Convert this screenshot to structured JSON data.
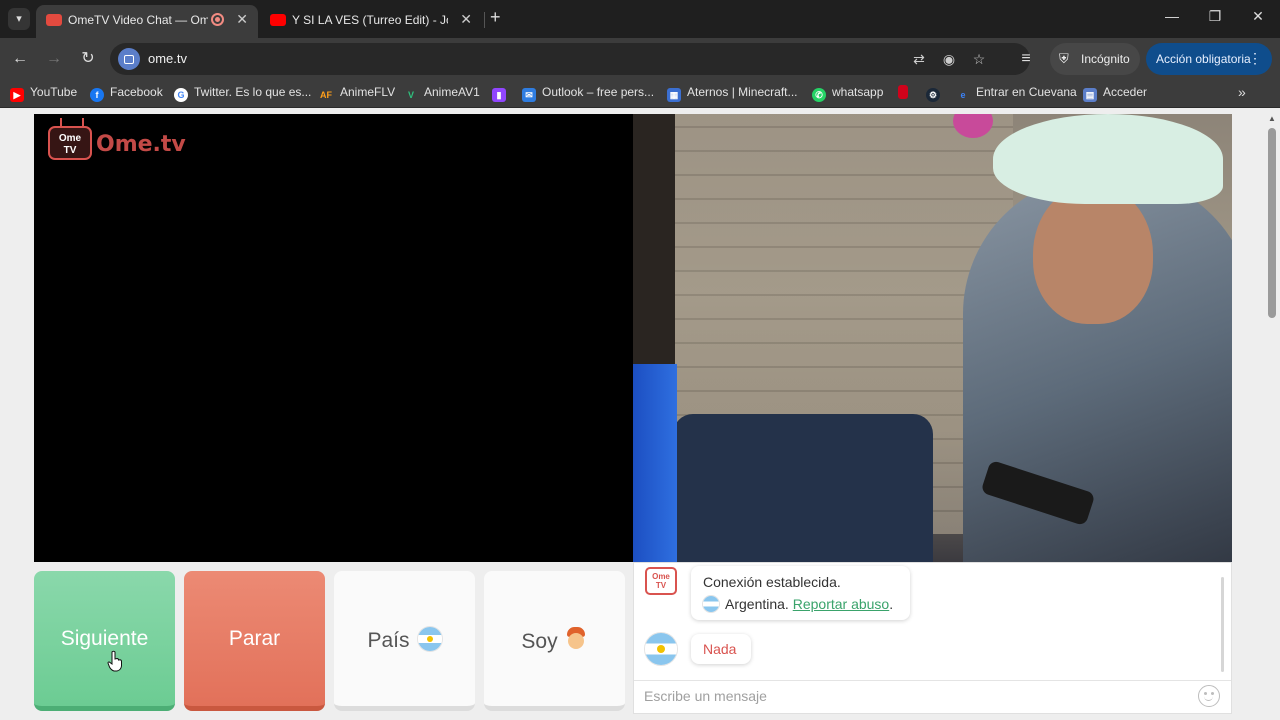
{
  "browser": {
    "tabs": [
      {
        "title": "OmeTV Video Chat — Ome",
        "active": true,
        "favicon": "ometv-favicon",
        "recording": true
      },
      {
        "title": "Y SI LA VES (Turreo Edit) - Jona",
        "active": false,
        "favicon": "youtube-favicon"
      }
    ],
    "url": "ome.tv",
    "incognito_label": "Incógnito",
    "action_label": "Acción obligatoria",
    "bookmarks": [
      {
        "label": "YouTube",
        "icon": "youtube-icon",
        "color": "#ff0000"
      },
      {
        "label": "Facebook",
        "icon": "facebook-icon",
        "color": "#1877f2"
      },
      {
        "label": "Twitter. Es lo que es...",
        "icon": "google-icon",
        "color": "#ffffff"
      },
      {
        "label": "AnimeFLV",
        "icon": "animeflv-icon",
        "color": "#3c3c3c"
      },
      {
        "label": "AnimeAV1",
        "icon": "animeav1-icon",
        "color": "#2ec27e"
      },
      {
        "label": "",
        "icon": "twitch-icon",
        "color": "#9146ff"
      },
      {
        "label": "Outlook – free pers...",
        "icon": "outlook-icon",
        "color": "#2f7de1"
      },
      {
        "label": "Aternos | Minecraft...",
        "icon": "aternos-icon",
        "color": "#3b6fd1"
      },
      {
        "label": "whatsapp",
        "icon": "whatsapp-icon",
        "color": "#25d366"
      },
      {
        "label": "",
        "icon": "red-bookmark-icon",
        "color": "#d0021b"
      },
      {
        "label": "",
        "icon": "steam-icon",
        "color": "#1b2838"
      },
      {
        "label": "Entrar en Cuevana",
        "icon": "cuevana-icon",
        "color": "#3b82f6"
      },
      {
        "label": "Acceder",
        "icon": "acceder-icon",
        "color": "#5b7ec9"
      }
    ]
  },
  "site": {
    "logo_text": "Ome.tv",
    "logo_badge": "Ome\nTV",
    "controls": {
      "next": "Siguiente",
      "stop": "Parar",
      "country": "País",
      "gender": "Soy"
    },
    "chat": {
      "system_avatar_text": "Ome\nTV",
      "connected": "Conexión establecida.",
      "country": "Argentina.",
      "report_link": "Reportar abuso",
      "report_suffix": ".",
      "peer_message": "Nada",
      "placeholder": "Escribe un mensaje"
    }
  },
  "colors": {
    "next_button": "#7ad39f",
    "stop_button": "#e77d66",
    "report_link": "#3aa36b",
    "peer_message": "#d9534f"
  }
}
